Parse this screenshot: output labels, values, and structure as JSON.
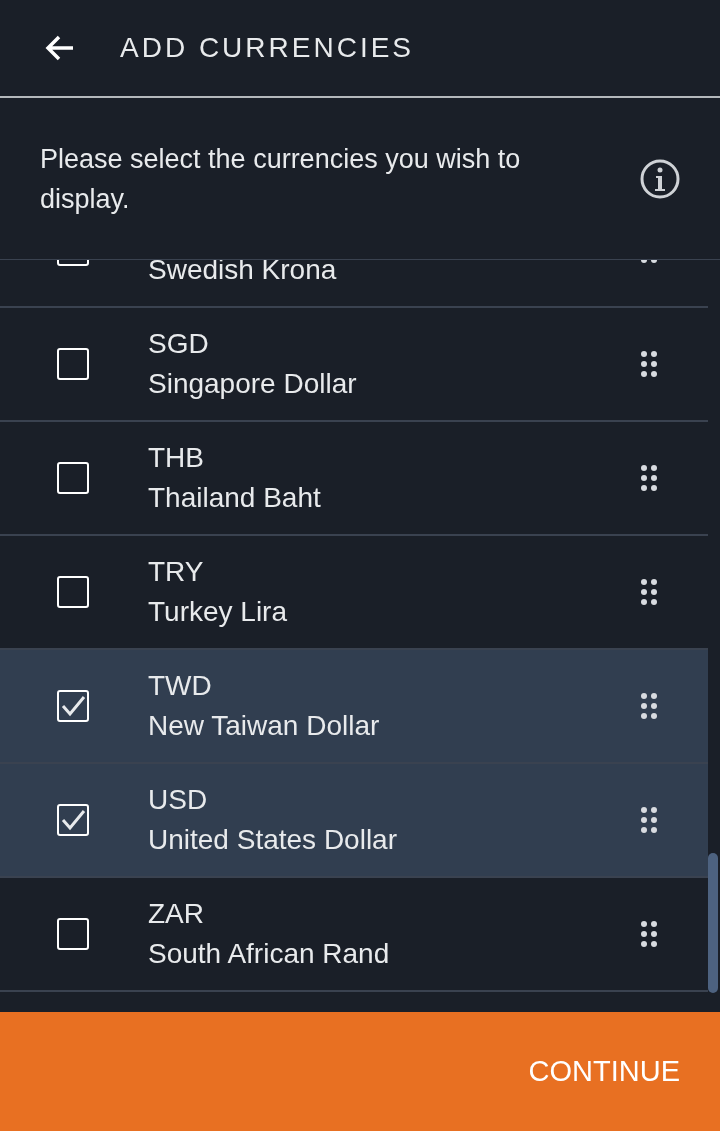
{
  "header": {
    "title": "ADD CURRENCIES"
  },
  "intro": {
    "text": "Please select the currencies you wish to display."
  },
  "currencies": [
    {
      "name": "Swedish Krona",
      "selected": false
    },
    {
      "code": "SGD",
      "name": "Singapore Dollar",
      "checked": false,
      "selected": false
    },
    {
      "code": "THB",
      "name": "Thailand Baht",
      "checked": false,
      "selected": false
    },
    {
      "code": "TRY",
      "name": "Turkey Lira",
      "checked": false,
      "selected": false
    },
    {
      "code": "TWD",
      "name": "New Taiwan Dollar",
      "checked": true,
      "selected": true
    },
    {
      "code": "USD",
      "name": "United States Dollar",
      "checked": true,
      "selected": true
    },
    {
      "code": "ZAR",
      "name": "South African Rand",
      "checked": false,
      "selected": false
    }
  ],
  "continue_button": {
    "label": "CONTINUE"
  }
}
